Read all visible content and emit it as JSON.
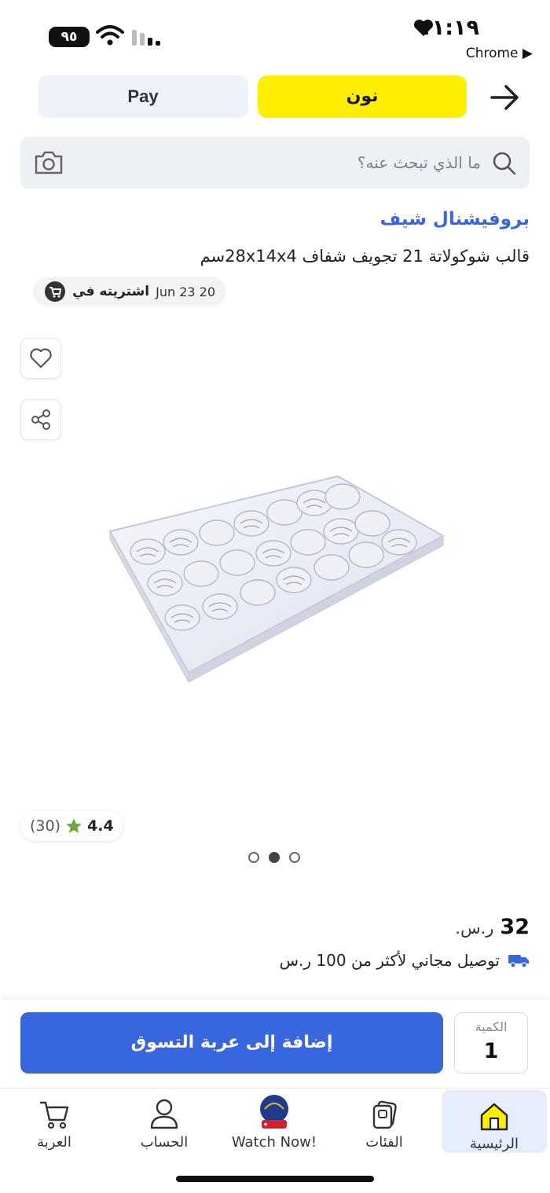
{
  "status_bar": {
    "time": "١١:١٩",
    "battery": "٩٥",
    "back_app": "Chrome ▶"
  },
  "header": {
    "tab_noon": "نون",
    "tab_pay": "Pay",
    "search_placeholder": "ما الذي تبحث عنه؟"
  },
  "product": {
    "brand": "بروفيشنال شيف",
    "title": "قالب شوكولاتة 21 تجويف شفاف 28x14x4سم",
    "purchased_label": "اشتريته في",
    "purchased_date": "Jun 23 20",
    "rating_value": "4.4",
    "rating_count": "(30)",
    "image_pages": 3,
    "image_active": 2,
    "price_amount": "32",
    "price_currency": "ر.س.",
    "delivery_text": "توصيل مجاني لأكثر من 100 ر.س"
  },
  "cart_bar": {
    "add_to_cart": "إضافة إلى عربة التسوق",
    "quantity_label": "الكمية",
    "quantity_value": "1"
  },
  "nav": {
    "home": "الرئيسية",
    "categories": "الفئات",
    "watch": "Watch Now!",
    "account": "الحساب",
    "cart": "العربة"
  },
  "colors": {
    "noon_yellow": "#feee00",
    "brand_blue": "#3866df",
    "rating_star": "#6aa839"
  }
}
